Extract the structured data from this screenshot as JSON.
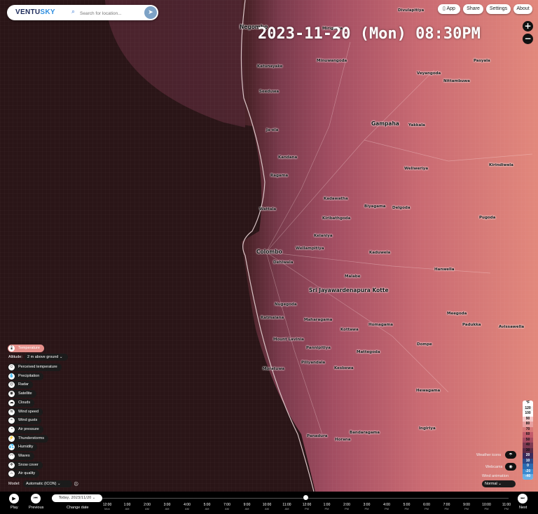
{
  "header": {
    "logo_prefix": "VENTU",
    "logo_suffix": "SKY",
    "search_placeholder": "Search for location..."
  },
  "top_buttons": {
    "app": "App",
    "share": "Share",
    "settings": "Settings",
    "about": "About"
  },
  "timestamp": "2023-11-20 (Mon) 08:30PM",
  "zoom": {
    "in": "+",
    "out": "−"
  },
  "places": [
    {
      "name": "Negombo",
      "big": true
    },
    {
      "name": "Colombo",
      "big": true
    },
    {
      "name": "Gampaha",
      "big": true
    },
    {
      "name": "Sri Jayawardenapura Kotte",
      "big": true
    },
    {
      "name": "Mirigama"
    },
    {
      "name": "Minuwangoda"
    },
    {
      "name": "Katunayake"
    },
    {
      "name": "Ja-ela"
    },
    {
      "name": "Kandana"
    },
    {
      "name": "Wattala"
    },
    {
      "name": "Kadawatha"
    },
    {
      "name": "Kiribathgoda"
    },
    {
      "name": "Kelaniya"
    },
    {
      "name": "Dehiwala"
    },
    {
      "name": "Moratuwa"
    },
    {
      "name": "Panadura"
    },
    {
      "name": "Horana"
    },
    {
      "name": "Kesbewa"
    },
    {
      "name": "Maharagama"
    },
    {
      "name": "Malabe"
    },
    {
      "name": "Kaduwela"
    },
    {
      "name": "Hanwella"
    },
    {
      "name": "Homagama"
    },
    {
      "name": "Piliyandala"
    },
    {
      "name": "Padukka"
    },
    {
      "name": "Avissawella"
    },
    {
      "name": "Yakkala"
    },
    {
      "name": "Nittambuwa"
    },
    {
      "name": "Veyangoda"
    },
    {
      "name": "Kirindiwela"
    },
    {
      "name": "Pugoda"
    },
    {
      "name": "Dompe"
    },
    {
      "name": "Biyagama"
    },
    {
      "name": "Ragama"
    },
    {
      "name": "Seeduwa"
    },
    {
      "name": "Divulapitiya"
    },
    {
      "name": "Pasyala"
    },
    {
      "name": "Weliweriya"
    },
    {
      "name": "Delgoda"
    },
    {
      "name": "Kottawa"
    },
    {
      "name": "Mattegoda"
    },
    {
      "name": "Bandaragama"
    },
    {
      "name": "Ingiriya"
    },
    {
      "name": "Meegoda"
    },
    {
      "name": "Hewagama"
    },
    {
      "name": "Ratmalana"
    },
    {
      "name": "Mount Lavinia"
    },
    {
      "name": "Nugegoda"
    },
    {
      "name": "Pannipitiya"
    },
    {
      "name": "Wellampitiya"
    }
  ],
  "layers": {
    "active": "Temperature",
    "altitude_label": "Altitude:",
    "altitude_value": "2 m above ground",
    "items": [
      "Perceived temperature",
      "Precipitation",
      "Radar",
      "Satellite",
      "Clouds",
      "Wind speed",
      "Wind gusts",
      "Air pressure",
      "Thunderstorms",
      "Humidity",
      "Waves",
      "Snow cover",
      "Air quality"
    ],
    "model_label": "Model:",
    "model_value": "Automatic (ICON)"
  },
  "weather_controls": {
    "weather_icons": "Weather icons",
    "webcams": "Webcams",
    "wind_animation": "Wind animation",
    "wind_value": "Normal"
  },
  "legend": {
    "unit": "°F",
    "values": [
      "120",
      "100",
      "90",
      "80",
      "70",
      "60",
      "50",
      "40",
      "30",
      "20",
      "10",
      "0",
      "-20",
      "-40"
    ],
    "colors": [
      "#f5f5f5",
      "#ffffff",
      "#f5c9c9",
      "#e8a0a0",
      "#d87878",
      "#c25a6a",
      "#a64a60",
      "#7e3a52",
      "#5a2a46",
      "#3a2a5a",
      "#2a4a8a",
      "#2a6ab0",
      "#3a8ad0",
      "#6ab0e6"
    ]
  },
  "playback": {
    "play": "Play",
    "previous": "Previous",
    "date_value": "Today, 2023/11/20",
    "change_date": "Change date",
    "next": "Next",
    "progress": 0.5
  },
  "timeline_ticks": [
    {
      "time": "12:00",
      "day": "Mon"
    },
    {
      "time": "1:00",
      "day": "AM"
    },
    {
      "time": "2:00",
      "day": "AM"
    },
    {
      "time": "3:00",
      "day": "AM"
    },
    {
      "time": "4:00",
      "day": "AM"
    },
    {
      "time": "5:00",
      "day": "AM"
    },
    {
      "time": "7:00",
      "day": "AM"
    },
    {
      "time": "9:00",
      "day": "AM"
    },
    {
      "time": "10:00",
      "day": "AM"
    },
    {
      "time": "11:00",
      "day": "AM"
    },
    {
      "time": "12:00",
      "day": "PM"
    },
    {
      "time": "1:00",
      "day": "PM"
    },
    {
      "time": "2:00",
      "day": "PM"
    },
    {
      "time": "3:00",
      "day": "PM"
    },
    {
      "time": "4:00",
      "day": "PM"
    },
    {
      "time": "5:00",
      "day": "PM"
    },
    {
      "time": "6:00",
      "day": "PM"
    },
    {
      "time": "7:00",
      "day": "PM"
    },
    {
      "time": "9:00",
      "day": "PM"
    },
    {
      "time": "10:00",
      "day": "PM"
    },
    {
      "time": "11:00",
      "day": "PM"
    }
  ]
}
